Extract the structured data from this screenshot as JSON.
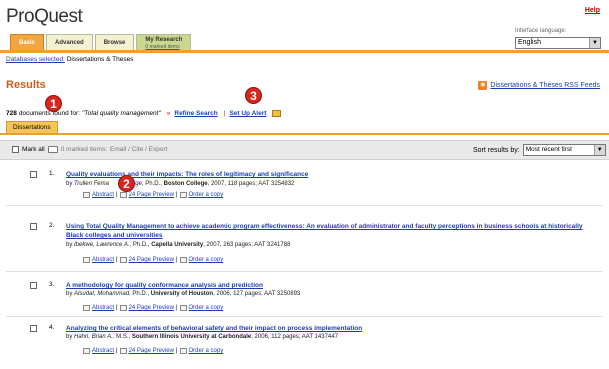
{
  "header": {
    "logo": "ProQuest",
    "help": "Help",
    "language_label": "Interface language:",
    "language_value": "English"
  },
  "tabs": [
    {
      "label": "Basic",
      "active": true
    },
    {
      "label": "Advanced",
      "active": false
    },
    {
      "label": "Browse",
      "active": false
    },
    {
      "label": "My Research",
      "sublabel": "0 marked items",
      "active": false
    }
  ],
  "databases": {
    "label": "Databases selected:",
    "value": "Dissertations & Theses"
  },
  "results": {
    "title": "Results",
    "rss": "Dissertations & Theses RSS Feeds",
    "count": "728",
    "count_text": "documents found for:",
    "query": "\"Total quality management\"",
    "refine": "Refine Search",
    "separator": "|",
    "alert": "Set Up Alert",
    "tab": "Dissertations"
  },
  "toolbar": {
    "mark_all": "Mark all",
    "marked": "0 marked items:",
    "actions": "Email / Cite / Export",
    "sort_label": "Sort results by:",
    "sort_value": "Most recent first"
  },
  "items": [
    {
      "num": "1.",
      "title": "Quality evaluations and their impacts: The roles of legitimacy and significance",
      "by": "by",
      "author": "Trullen Fema",
      "author2": "Jorge",
      "degree": ", Ph.D.,",
      "school": "Boston College",
      "rest": ", 2007, 118 pages; AAT 3254832",
      "abstract": "Abstract",
      "preview": "24 Page Preview",
      "order": "Order a copy"
    },
    {
      "num": "2.",
      "title": "Using Total Quality Management to achieve academic program effectiveness: An evaluation of administrator and faculty perceptions in business schools at historically Black colleges and universities",
      "by": "by",
      "author": "Ibekwe, Lawrence A.",
      "degree": ", Ph.D.,",
      "school": "Capella University",
      "rest": ", 2007, 263 pages; AAT 3241788",
      "abstract": "Abstract",
      "preview": "24 Page Preview",
      "order": "Order a copy"
    },
    {
      "num": "3.",
      "title": "A methodology for quality conformance analysis and prediction",
      "by": "by",
      "author": "Alsudat, Mohammad",
      "degree": ", Ph.D.,",
      "school": "University of Houston",
      "rest": ", 2006, 127 pages; AAT 3250893",
      "abstract": "Abstract",
      "preview": "24 Page Preview",
      "order": "Order a copy"
    },
    {
      "num": "4.",
      "title": "Analyzing the critical elements of behavioral safety and their impact on process implementation",
      "by": "by",
      "author": "Hahn, Brian A.",
      "degree": ", M.S.,",
      "school": "Southern Illinois University at Carbondale",
      "rest": ", 2006, 112 pages; AAT 1437447",
      "abstract": "Abstract",
      "preview": "24 Page Preview",
      "order": "Order a copy"
    }
  ],
  "callouts": [
    "1",
    "2",
    "3"
  ],
  "colors": {
    "accent_orange": "#f0a030",
    "link_blue": "#1a3fb0",
    "results_orange": "#c8601a",
    "callout_red": "#d7261e"
  }
}
